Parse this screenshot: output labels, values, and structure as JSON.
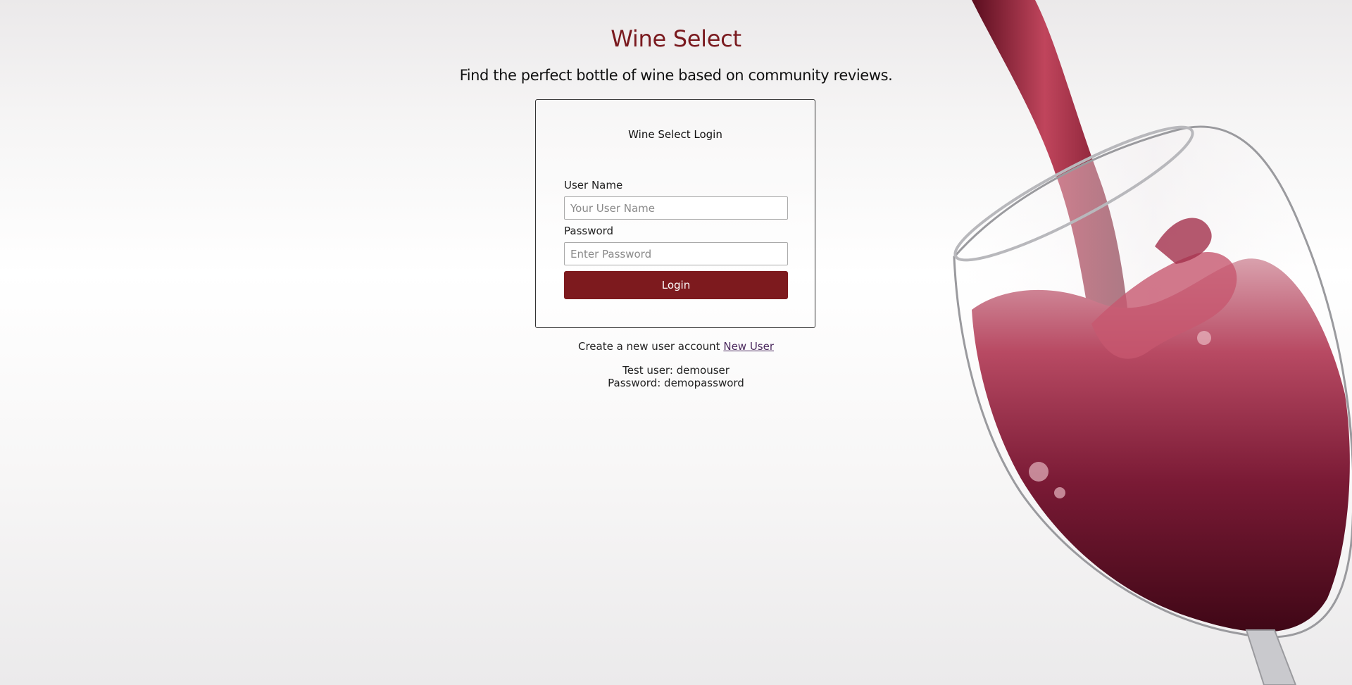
{
  "header": {
    "title": "Wine Select",
    "tagline": "Find the perfect bottle of wine based on community reviews."
  },
  "login": {
    "title": "Wine Select Login",
    "username_label": "User Name",
    "username_placeholder": "Your User Name",
    "username_value": "",
    "password_label": "Password",
    "password_placeholder": "Enter Password",
    "password_value": "",
    "submit_label": "Login"
  },
  "signup": {
    "prompt": "Create a new user account",
    "link_label": "New User"
  },
  "demo": {
    "user_line": "Test user: demouser",
    "password_line": "Password: demopassword"
  },
  "colors": {
    "accent": "#7d1a1e",
    "title": "#7a1a1f",
    "link": "#4b2a5e"
  },
  "background": {
    "image": "wine-glass-pour"
  }
}
